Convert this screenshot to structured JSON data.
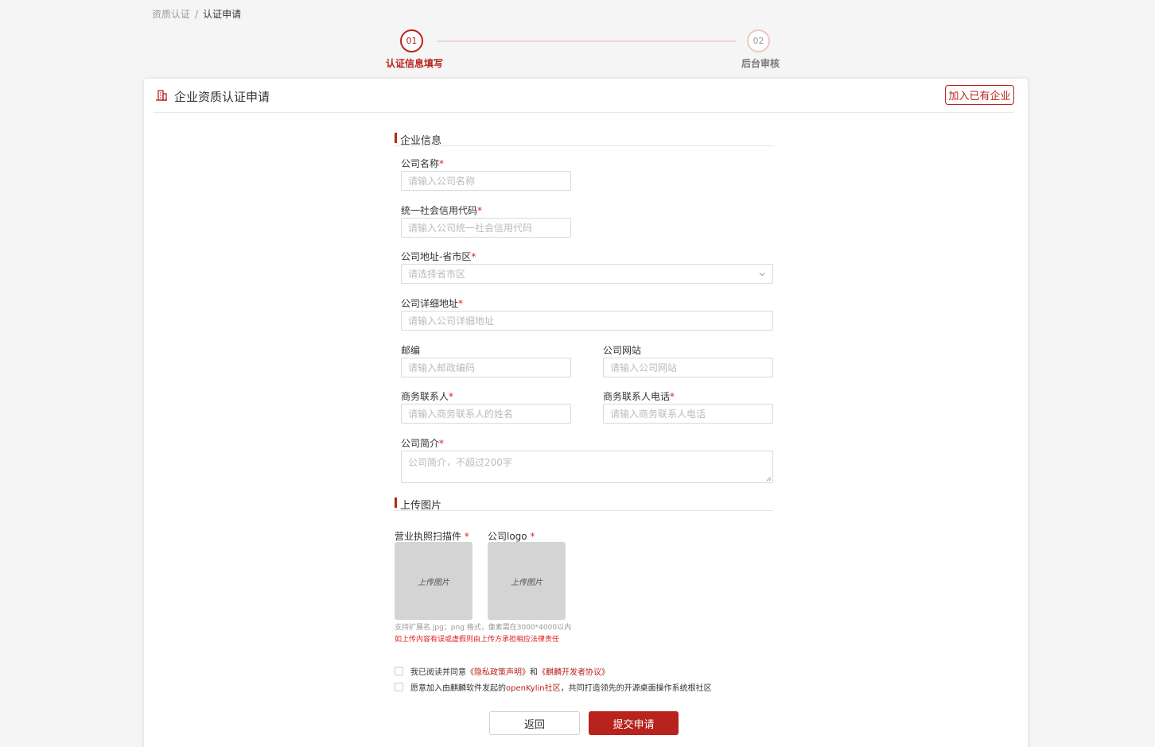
{
  "breadcrumb": {
    "parent": "资质认证",
    "separator": "/",
    "current": "认证申请"
  },
  "steps": [
    {
      "number": "01",
      "label": "认证信息填写",
      "active": true
    },
    {
      "number": "02",
      "label": "后台审核",
      "active": false
    }
  ],
  "card": {
    "title": "企业资质认证申请",
    "join_button": "加入已有企业"
  },
  "sections": {
    "company_info": "企业信息",
    "upload_images": "上传图片"
  },
  "form": {
    "company_name": {
      "label": "公司名称",
      "required": "*",
      "placeholder": "请输入公司名称"
    },
    "credit_code": {
      "label": "统一社会信用代码",
      "required": "*",
      "placeholder": "请输入公司统一社会信用代码"
    },
    "region": {
      "label": "公司地址-省市区",
      "required": "*",
      "placeholder": "请选择省市区"
    },
    "address": {
      "label": "公司详细地址",
      "required": "*",
      "placeholder": "请输入公司详细地址"
    },
    "postcode": {
      "label": "邮编",
      "placeholder": "请输入邮政编码"
    },
    "website": {
      "label": "公司网站",
      "placeholder": "请输入公司网站"
    },
    "contact": {
      "label": "商务联系人",
      "required": "*",
      "placeholder": "请输入商务联系人的姓名"
    },
    "contact_phone": {
      "label": "商务联系人电话",
      "required": "*",
      "placeholder": "请输入商务联系人电话"
    },
    "intro": {
      "label": "公司简介",
      "required": "*",
      "placeholder": "公司简介，不超过200字"
    }
  },
  "upload": {
    "license": {
      "label": "营业执照扫描件",
      "required": "*",
      "button": "上传图片"
    },
    "logo": {
      "label": "公司logo",
      "required": "*",
      "button": "上传图片"
    },
    "format_hint": "支持扩展名 jpg；png 格式，像素需在3000*4000以内",
    "liability_hint": "如上传内容有误或虚假则由上传方承担相应法律责任"
  },
  "agreements": {
    "row1_prefix": "我已阅读并同意",
    "privacy_link": "《隐私政策声明》",
    "row1_and": "和",
    "developer_link": "《麒麟开发者协议》",
    "row2_prefix": "愿意加入由麒麟软件发起的",
    "openkylin_link": "openKylin社区",
    "row2_suffix": "，共同打造领先的开源桌面操作系统根社区"
  },
  "buttons": {
    "back": "返回",
    "submit": "提交申请"
  },
  "colors": {
    "accent": "#b8231d",
    "required": "#e02020"
  }
}
